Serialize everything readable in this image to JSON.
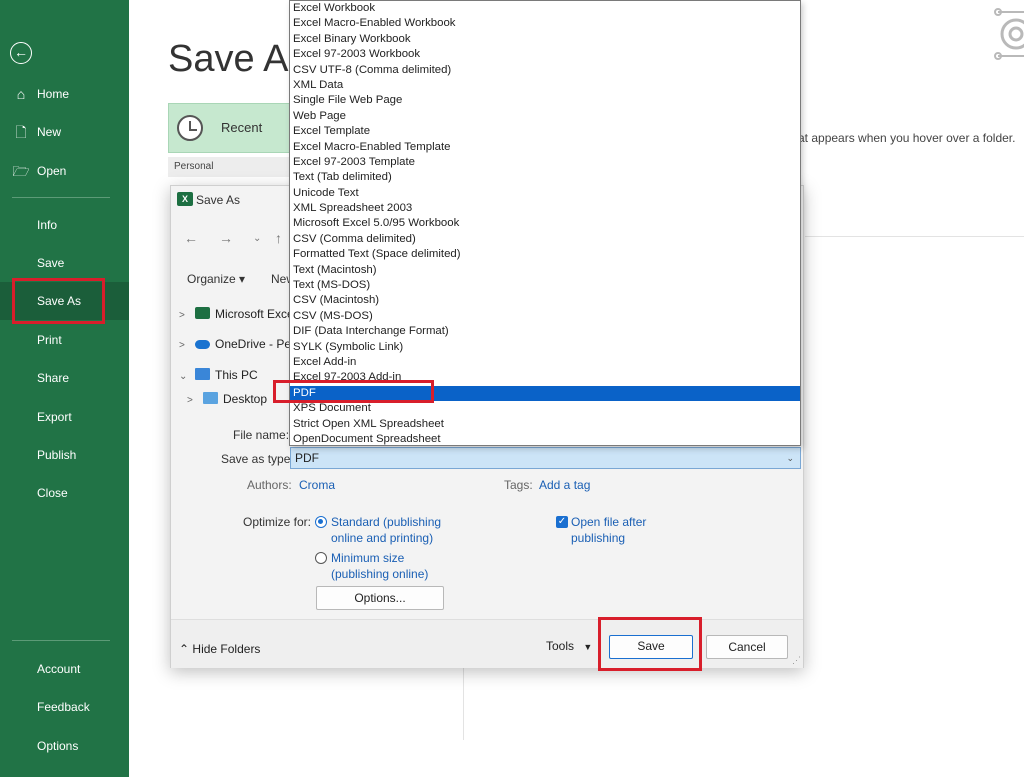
{
  "sidebar": {
    "items": [
      {
        "label": "Home",
        "icon": "home-icon"
      },
      {
        "label": "New",
        "icon": "new-file-icon"
      },
      {
        "label": "Open",
        "icon": "folder-icon"
      },
      {
        "label": "Info"
      },
      {
        "label": "Save"
      },
      {
        "label": "Save As",
        "selected": true
      },
      {
        "label": "Print"
      },
      {
        "label": "Share"
      },
      {
        "label": "Export"
      },
      {
        "label": "Publish"
      },
      {
        "label": "Close"
      }
    ],
    "bottom": [
      {
        "label": "Account"
      },
      {
        "label": "Feedback"
      },
      {
        "label": "Options"
      }
    ],
    "color": "#217346"
  },
  "backstage": {
    "title": "Save As",
    "recent_label": "Recent",
    "personal_label": "Personal",
    "hover_hint": "at appears when you hover over a folder."
  },
  "dialog": {
    "title": "Save As",
    "organize_label": "Organize ▾",
    "new_folder_label": "New",
    "tree": [
      {
        "label": "Microsoft Excel",
        "icon": "excel-icon"
      },
      {
        "label": "OneDrive - Pers",
        "icon": "cloud-icon"
      },
      {
        "label": "This PC",
        "icon": "pc-icon"
      },
      {
        "label": "Desktop",
        "icon": "desktop-icon"
      }
    ],
    "file_name_label": "File name:",
    "save_as_type_label": "Save as type:",
    "save_as_type_value": "PDF",
    "authors_label": "Authors:",
    "authors_value": "Croma",
    "tags_label": "Tags:",
    "tags_value": "Add a tag",
    "optimize_label": "Optimize for:",
    "optimize_standard_1": "Standard (publishing",
    "optimize_standard_2": "online and printing)",
    "optimize_minimum_1": "Minimum size",
    "optimize_minimum_2": "(publishing online)",
    "open_after_1": "Open file after",
    "open_after_2": "publishing",
    "options_button": "Options...",
    "hide_folders": "Hide Folders",
    "tools": "Tools",
    "save_button": "Save",
    "cancel_button": "Cancel"
  },
  "file_types": [
    "Excel Workbook",
    "Excel Macro-Enabled Workbook",
    "Excel Binary Workbook",
    "Excel 97-2003 Workbook",
    "CSV UTF-8 (Comma delimited)",
    "XML Data",
    "Single File Web Page",
    "Web Page",
    "Excel Template",
    "Excel Macro-Enabled Template",
    "Excel 97-2003 Template",
    "Text (Tab delimited)",
    "Unicode Text",
    "XML Spreadsheet 2003",
    "Microsoft Excel 5.0/95 Workbook",
    "CSV (Comma delimited)",
    "Formatted Text (Space delimited)",
    "Text (Macintosh)",
    "Text (MS-DOS)",
    "CSV (Macintosh)",
    "CSV (MS-DOS)",
    "DIF (Data Interchange Format)",
    "SYLK (Symbolic Link)",
    "Excel Add-in",
    "Excel 97-2003 Add-in",
    "PDF",
    "XPS Document",
    "Strict Open XML Spreadsheet",
    "OpenDocument Spreadsheet"
  ],
  "selected_file_type": "PDF",
  "annotation_color": "#d81e2b"
}
